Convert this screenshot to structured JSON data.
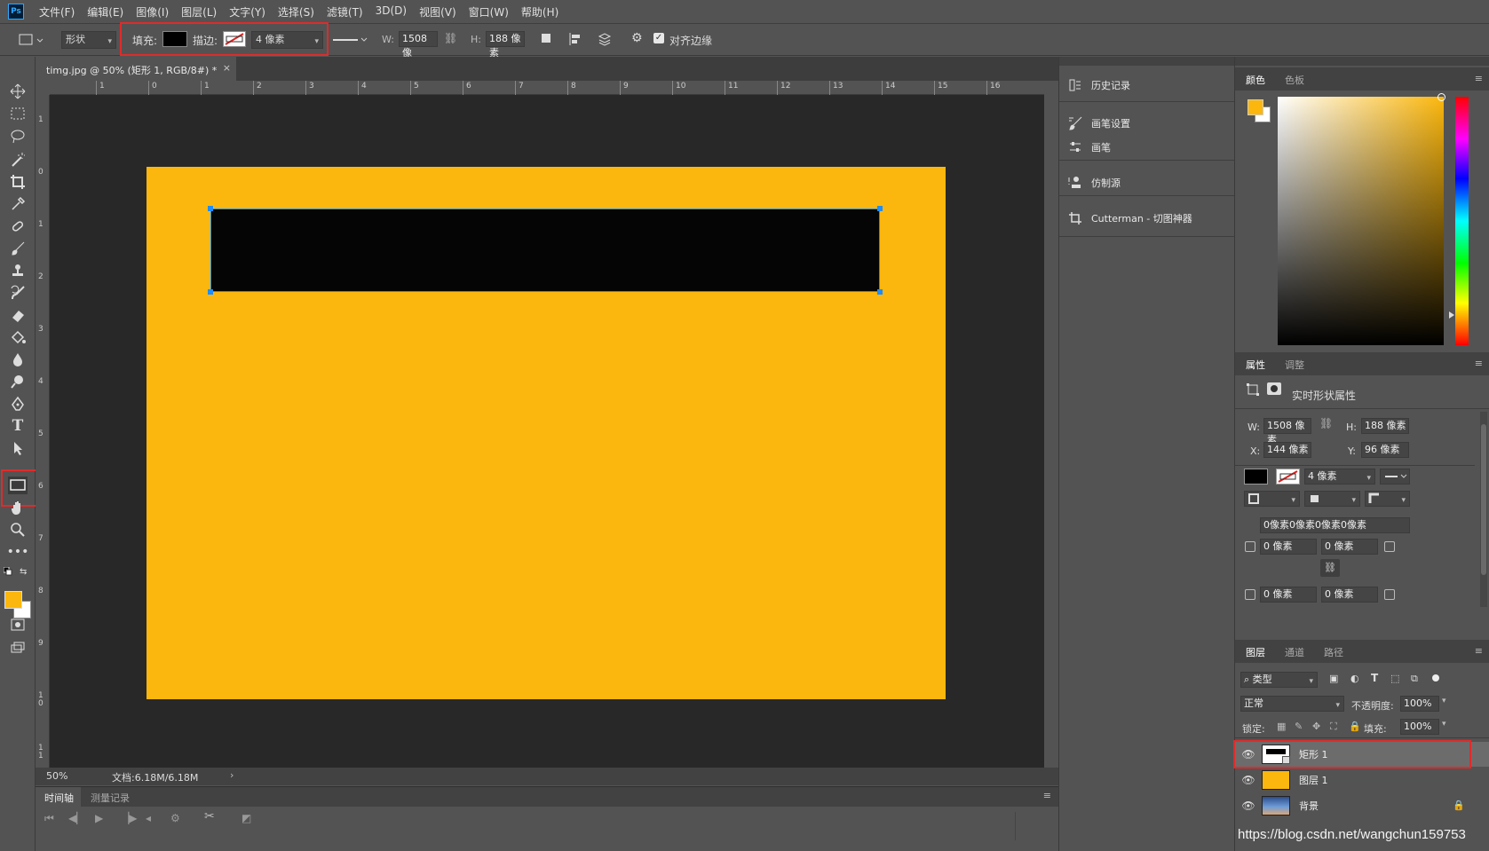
{
  "app": {
    "logo": "Ps"
  },
  "menu": [
    "文件(F)",
    "编辑(E)",
    "图像(I)",
    "图层(L)",
    "文字(Y)",
    "选择(S)",
    "滤镜(T)",
    "3D(D)",
    "视图(V)",
    "窗口(W)",
    "帮助(H)"
  ],
  "options": {
    "mode": "形状",
    "fill_label": "填充:",
    "stroke_label": "描边:",
    "stroke_size": "4 像素",
    "w_label": "W:",
    "w_value": "1508 像",
    "h_label": "H:",
    "h_value": "188 像素",
    "align_edges": "对齐边缘",
    "fill_color": "#000000"
  },
  "document": {
    "tab_title": "timg.jpg @ 50% (矩形 1, RGB/8#) *",
    "zoom": "50%",
    "doc_info": "文档:6.18M/6.18M",
    "canvas_color": "#fbb70d",
    "shape_color": "#050505",
    "ruler_top": [
      "1",
      "0",
      "1",
      "2",
      "3",
      "4",
      "5",
      "6",
      "7",
      "8",
      "9",
      "10",
      "11",
      "12",
      "13",
      "14",
      "15",
      "16"
    ],
    "ruler_left": [
      "1",
      "0",
      "1",
      "2",
      "3",
      "4",
      "5",
      "6",
      "7",
      "8",
      "9",
      "1\n0",
      "1\n1"
    ]
  },
  "timeline": {
    "tabs": [
      "时间轴",
      "测量记录"
    ]
  },
  "mid_panel": {
    "items": [
      "历史记录",
      "画笔设置",
      "画笔",
      "仿制源",
      "Cutterman - 切图神器"
    ]
  },
  "color_panel": {
    "tabs": [
      "颜色",
      "色板"
    ],
    "foreground": "#fbb70d",
    "background": "#ffffff"
  },
  "properties": {
    "tabs": [
      "属性",
      "调整"
    ],
    "title": "实时形状属性",
    "w_label": "W:",
    "w_value": "1508 像素",
    "h_label": "H:",
    "h_value": "188 像素",
    "x_label": "X:",
    "x_value": "144 像素",
    "y_label": "Y:",
    "y_value": "96 像素",
    "stroke_size": "4 像素",
    "corners": "0像素0像素0像素0像素",
    "corner1": "0 像素",
    "corner2": "0 像素",
    "corner3": "0 像素",
    "corner4": "0 像素"
  },
  "layers": {
    "tabs": [
      "图层",
      "通道",
      "路径"
    ],
    "filter": "类型",
    "blend": "正常",
    "opacity_label": "不透明度:",
    "opacity": "100%",
    "lock_label": "锁定:",
    "fill_label": "填充:",
    "fill": "100%",
    "rows": [
      {
        "name": "矩形 1"
      },
      {
        "name": "图层 1"
      },
      {
        "name": "背景"
      }
    ]
  },
  "watermark": "https://blog.csdn.net/wangchun159753"
}
